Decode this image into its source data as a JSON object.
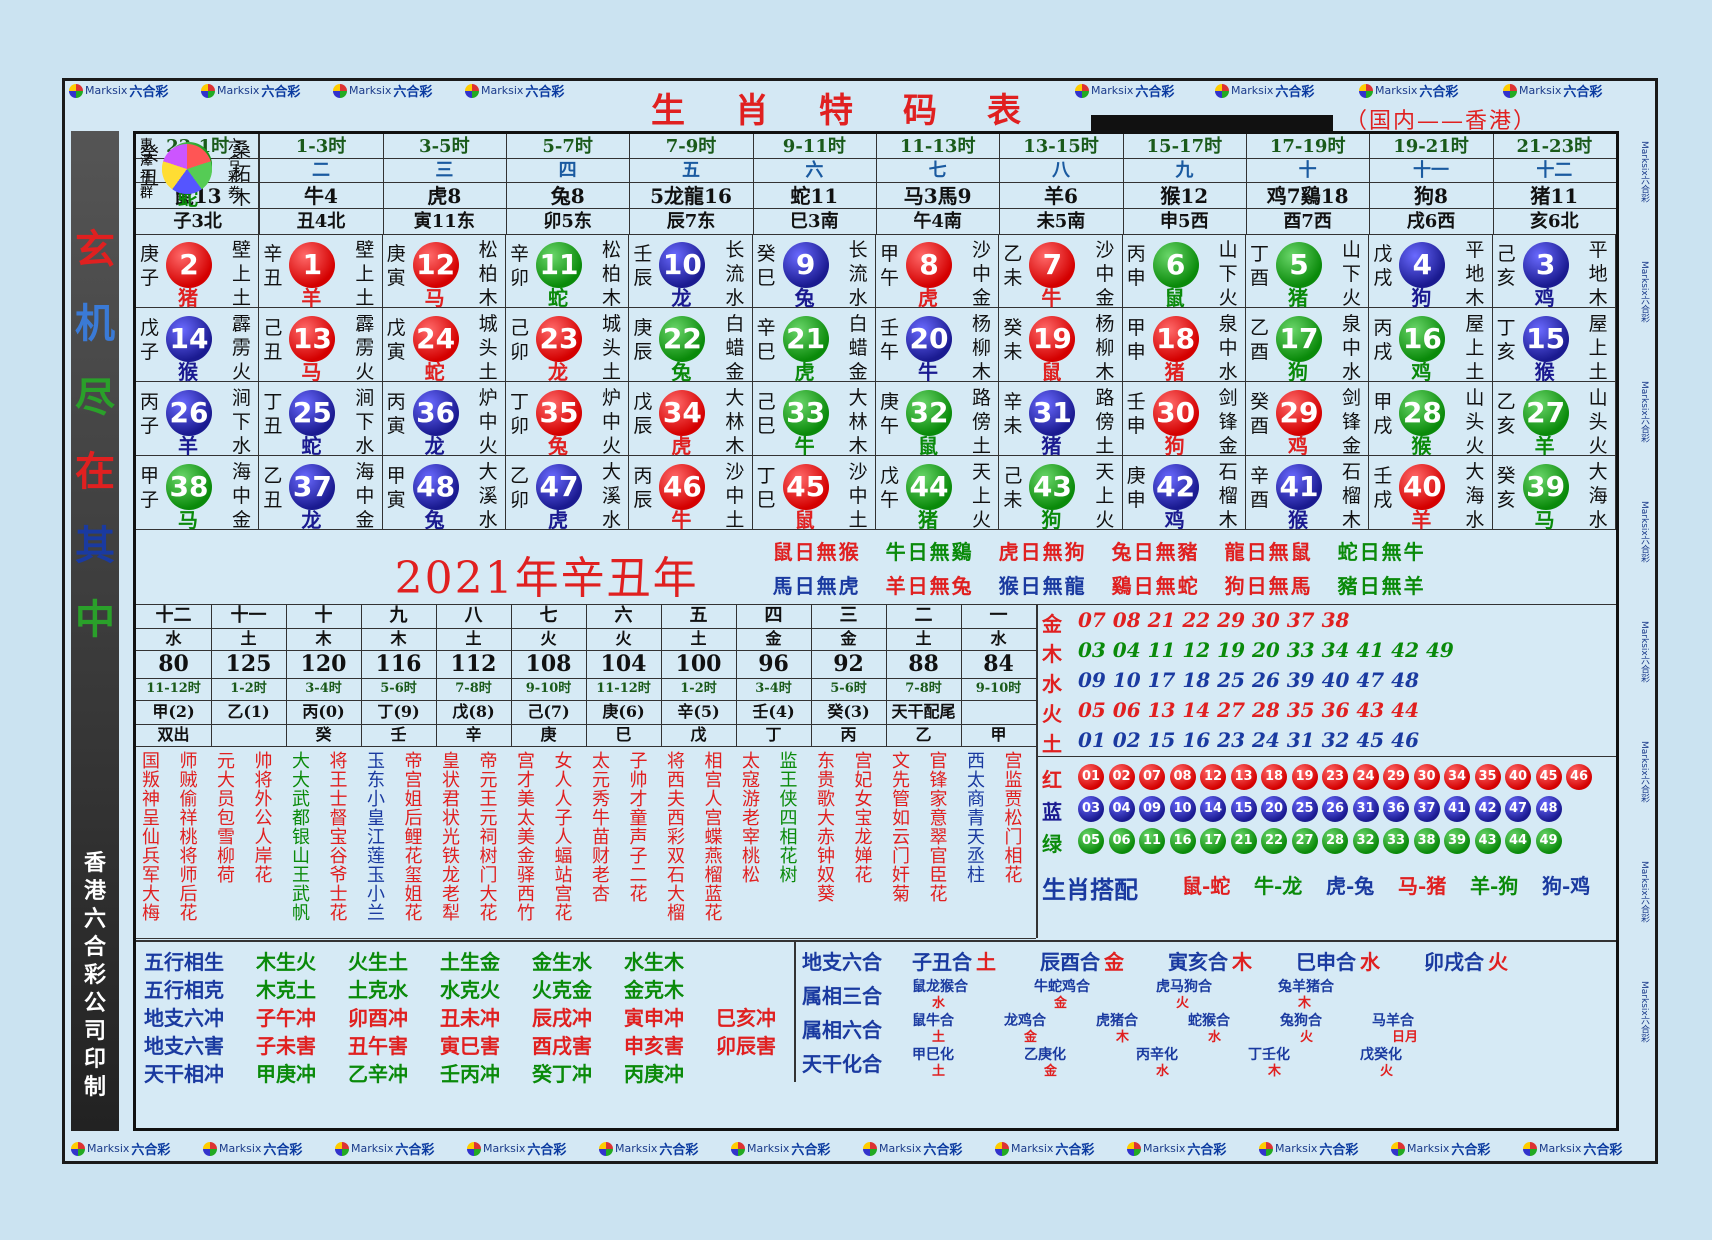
{
  "brand": {
    "name": "Marksix",
    "cn": "六合彩"
  },
  "title": "生肖特码表",
  "subtitle": "（国内——香港）",
  "left_vertical": [
    "玄",
    "机",
    "尽",
    "在",
    "其",
    "中"
  ],
  "left_bottom": "香港六合彩公司印制",
  "hours": [
    "23-1时",
    "1-3时",
    "3-5时",
    "5-7时",
    "7-9时",
    "9-11时",
    "11-13时",
    "13-15时",
    "15-17时",
    "17-19时",
    "19-21时",
    "21-23时"
  ],
  "orders": [
    "一",
    "二",
    "三",
    "四",
    "五",
    "六",
    "七",
    "八",
    "九",
    "十",
    "十一",
    "十二"
  ],
  "zodiacs": [
    "鼠13",
    "牛4",
    "虎8",
    "兔8",
    "5龙龍16",
    "蛇11",
    "马3馬9",
    "羊6",
    "猴12",
    "鸡7鷄18",
    "狗8",
    "猪11"
  ],
  "branches": [
    "子3北",
    "丑4北",
    "寅11东",
    "卯5东",
    "辰7东",
    "巳3南",
    "午4南",
    "未5南",
    "申5西",
    "酉7西",
    "戌6西",
    "亥6北"
  ],
  "rows": [
    [
      [
        "庚子",
        "2",
        "red",
        "猪",
        "壁上土"
      ],
      [
        "辛丑",
        "1",
        "red",
        "羊",
        "壁上土"
      ],
      [
        "庚寅",
        "12",
        "red",
        "马",
        "松柏木"
      ],
      [
        "辛卯",
        "11",
        "green",
        "蛇",
        "松柏木"
      ],
      [
        "壬辰",
        "10",
        "blue",
        "龙",
        "长流水"
      ],
      [
        "癸巳",
        "9",
        "blue",
        "兔",
        "长流水"
      ],
      [
        "甲午",
        "8",
        "red",
        "虎",
        "沙中金"
      ],
      [
        "乙未",
        "7",
        "red",
        "牛",
        "沙中金"
      ],
      [
        "丙申",
        "6",
        "green",
        "鼠",
        "山下火"
      ],
      [
        "丁酉",
        "5",
        "green",
        "猪",
        "山下火"
      ],
      [
        "戊戌",
        "4",
        "blue",
        "狗",
        "平地木"
      ],
      [
        "己亥",
        "3",
        "blue",
        "鸡",
        "平地木"
      ]
    ],
    [
      [
        "戊子",
        "14",
        "blue",
        "猴",
        "霹雳火"
      ],
      [
        "己丑",
        "13",
        "red",
        "马",
        "霹雳火"
      ],
      [
        "戊寅",
        "24",
        "red",
        "蛇",
        "城头土"
      ],
      [
        "己卯",
        "23",
        "red",
        "龙",
        "城头土"
      ],
      [
        "庚辰",
        "22",
        "green",
        "兔",
        "白蜡金"
      ],
      [
        "辛巳",
        "21",
        "green",
        "虎",
        "白蜡金"
      ],
      [
        "壬午",
        "20",
        "blue",
        "牛",
        "杨柳木"
      ],
      [
        "癸未",
        "19",
        "red",
        "鼠",
        "杨柳木"
      ],
      [
        "甲申",
        "18",
        "red",
        "猪",
        "泉中水"
      ],
      [
        "乙酉",
        "17",
        "green",
        "狗",
        "泉中水"
      ],
      [
        "丙戌",
        "16",
        "green",
        "鸡",
        "屋上土"
      ],
      [
        "丁亥",
        "15",
        "blue",
        "猴",
        "屋上土"
      ]
    ],
    [
      [
        "丙子",
        "26",
        "blue",
        "羊",
        "涧下水"
      ],
      [
        "丁丑",
        "25",
        "blue",
        "蛇",
        "涧下水"
      ],
      [
        "丙寅",
        "36",
        "blue",
        "龙",
        "炉中火"
      ],
      [
        "丁卯",
        "35",
        "red",
        "兔",
        "炉中火"
      ],
      [
        "戊辰",
        "34",
        "red",
        "虎",
        "大林木"
      ],
      [
        "己巳",
        "33",
        "green",
        "牛",
        "大林木"
      ],
      [
        "庚午",
        "32",
        "green",
        "鼠",
        "路傍土"
      ],
      [
        "辛未",
        "31",
        "blue",
        "猪",
        "路傍土"
      ],
      [
        "壬申",
        "30",
        "red",
        "狗",
        "剑锋金"
      ],
      [
        "癸酉",
        "29",
        "red",
        "鸡",
        "剑锋金"
      ],
      [
        "甲戌",
        "28",
        "green",
        "猴",
        "山头火"
      ],
      [
        "乙亥",
        "27",
        "green",
        "羊",
        "山头火"
      ]
    ],
    [
      [
        "甲子",
        "38",
        "green",
        "马",
        "海中金"
      ],
      [
        "乙丑",
        "37",
        "blue",
        "龙",
        "海中金"
      ],
      [
        "甲寅",
        "48",
        "blue",
        "兔",
        "大溪水"
      ],
      [
        "乙卯",
        "47",
        "blue",
        "虎",
        "大溪水"
      ],
      [
        "丙辰",
        "46",
        "red",
        "牛",
        "沙中土"
      ],
      [
        "丁巳",
        "45",
        "red",
        "鼠",
        "沙中土"
      ],
      [
        "戊午",
        "44",
        "green",
        "猪",
        "天上火"
      ],
      [
        "己未",
        "43",
        "green",
        "狗",
        "天上火"
      ],
      [
        "庚申",
        "42",
        "blue",
        "鸡",
        "石榴木"
      ],
      [
        "辛酉",
        "41",
        "blue",
        "猴",
        "石榴木"
      ],
      [
        "壬戌",
        "40",
        "red",
        "羊",
        "大海水"
      ],
      [
        "癸亥",
        "39",
        "green",
        "马",
        "大海水"
      ]
    ]
  ],
  "ball49": {
    "gz": "癸丑",
    "num": "49",
    "color": "green",
    "zo": "蛇",
    "ny": "桑柘木"
  },
  "club": {
    "left": "惠澤社群",
    "right": "六合彩券"
  },
  "year": "2021年辛丑年",
  "avoid_top": [
    "鼠日無猴",
    "牛日無鷄",
    "虎日無狗",
    "兔日無豬",
    "龍日無鼠",
    "蛇日無牛"
  ],
  "avoid_bot": [
    "馬日無虎",
    "羊日無兔",
    "猴日無龍",
    "鷄日無蛇",
    "狗日無馬",
    "豬日無羊"
  ],
  "mid_cols": [
    [
      "十二",
      "水",
      "80",
      "11-12时",
      "甲(2)",
      "双出"
    ],
    [
      "十一",
      "土",
      "125",
      "1-2时",
      "乙(1)",
      ""
    ],
    [
      "十",
      "木",
      "120",
      "3-4时",
      "丙(0)",
      "癸"
    ],
    [
      "九",
      "木",
      "116",
      "5-6时",
      "丁(9)",
      "壬"
    ],
    [
      "八",
      "土",
      "112",
      "7-8时",
      "戊(8)",
      "辛"
    ],
    [
      "七",
      "火",
      "108",
      "9-10时",
      "己(7)",
      "庚"
    ],
    [
      "六",
      "火",
      "104",
      "11-12时",
      "庚(6)",
      "巳"
    ],
    [
      "五",
      "土",
      "100",
      "1-2时",
      "辛(5)",
      "戊"
    ],
    [
      "四",
      "金",
      "96",
      "3-4时",
      "壬(4)",
      "丁"
    ],
    [
      "三",
      "金",
      "92",
      "5-6时",
      "癸(3)",
      "丙"
    ],
    [
      "二",
      "土",
      "88",
      "7-8时",
      "天干配尾",
      "乙"
    ],
    [
      "一",
      "水",
      "84",
      "9-10时",
      "",
      "甲"
    ]
  ],
  "poems": [
    "国叛神呈仙兵军大梅",
    "师贼偷祥桃将师后花",
    "元大员包雪柳荷",
    "帅将外公人岸花",
    "大大武都银山王武帆",
    "将王士督宝谷爷士花",
    "玉东小皇江莲玉小兰",
    "帝宫姐后鲤花玺姐花",
    "皇状君状光铁龙老犁",
    "帝元王元祠树门大花",
    "宫才美太美金驿西竹",
    "女人人子人蝠站宫花",
    "太元秀牛苗财老杏",
    "子帅才童声子二花",
    "将西夫西彩双石大榴",
    "相宫人宫蝶燕榴蓝花",
    "太寇游老宰桃松",
    "监王侠四相花树",
    "东贵歌大赤钟奴葵",
    "宫妃女宝龙婵花",
    "文先管如云门奸菊",
    "官锋家意翠官臣花",
    "西太商青天丞柱",
    "宫监贾松门相花"
  ],
  "five_elems": [
    {
      "k": "金",
      "v": "07 08 21 22 29 30 37 38"
    },
    {
      "k": "木",
      "v": "03 04 11 12 19 20 33 34 41 42 49"
    },
    {
      "k": "水",
      "v": "09 10 17 18 25 26 39 40 47 48"
    },
    {
      "k": "火",
      "v": "05 06 13 14 27 28 35 36 43 44"
    },
    {
      "k": "土",
      "v": "01 02 15 16 23 24 31 32 45 46"
    }
  ],
  "wave": {
    "red": {
      "k": "红",
      "nums": [
        "01",
        "02",
        "07",
        "08",
        "12",
        "13",
        "18",
        "19",
        "23",
        "24",
        "29",
        "30",
        "34",
        "35",
        "40",
        "45",
        "46"
      ]
    },
    "blue": {
      "k": "蓝",
      "nums": [
        "03",
        "04",
        "09",
        "10",
        "14",
        "15",
        "20",
        "25",
        "26",
        "31",
        "36",
        "37",
        "41",
        "42",
        "47",
        "48"
      ]
    },
    "green": {
      "k": "绿",
      "nums": [
        "05",
        "06",
        "11",
        "16",
        "17",
        "21",
        "22",
        "27",
        "28",
        "32",
        "33",
        "38",
        "39",
        "43",
        "44",
        "49"
      ]
    }
  },
  "pairing": {
    "label": "生肖搭配",
    "items": [
      "鼠-蛇",
      "牛-龙",
      "虎-兔",
      "马-猪",
      "羊-狗",
      "狗-鸡"
    ]
  },
  "bottom_left": [
    {
      "k": "五行相生",
      "v": [
        "木生火",
        "火生土",
        "土生金",
        "金生水",
        "水生木"
      ]
    },
    {
      "k": "五行相克",
      "v": [
        "木克土",
        "土克水",
        "水克火",
        "火克金",
        "金克木"
      ]
    },
    {
      "k": "地支六冲",
      "v": [
        "子午冲",
        "卯酉冲",
        "丑未冲",
        "辰戌冲",
        "寅申冲",
        "巳亥冲"
      ]
    },
    {
      "k": "地支六害",
      "v": [
        "子未害",
        "丑午害",
        "寅巳害",
        "酉戌害",
        "申亥害",
        "卯辰害"
      ]
    },
    {
      "k": "天干相冲",
      "v": [
        "甲庚冲",
        "乙辛冲",
        "壬丙冲",
        "癸丁冲",
        "丙庚冲"
      ]
    }
  ],
  "bottom_right": {
    "six_he": {
      "k": "地支六合",
      "v": [
        [
          "子丑合",
          "土"
        ],
        [
          "辰酉合",
          "金"
        ],
        [
          "寅亥合",
          "木"
        ],
        [
          "巳申合",
          "水"
        ],
        [
          "卯戌合",
          "火"
        ]
      ]
    },
    "three_he": {
      "k": "属相三合",
      "v": [
        [
          "鼠龙猴合",
          "水"
        ],
        [
          "牛蛇鸡合",
          "金"
        ],
        [
          "虎马狗合",
          "火"
        ],
        [
          "兔羊猪合",
          "木"
        ]
      ]
    },
    "six_he2": {
      "k": "属相六合",
      "v": [
        [
          "鼠牛合",
          "土"
        ],
        [
          "龙鸡合",
          "金"
        ],
        [
          "虎猪合",
          "木"
        ],
        [
          "蛇猴合",
          "水"
        ],
        [
          "兔狗合",
          "火"
        ],
        [
          "马羊合",
          "日月"
        ]
      ]
    },
    "tg_he": {
      "k": "天干化合",
      "v": [
        [
          "甲巳化",
          "土"
        ],
        [
          "乙庚化",
          "金"
        ],
        [
          "丙辛化",
          "水"
        ],
        [
          "丁壬化",
          "木"
        ],
        [
          "戊癸化",
          "火"
        ]
      ]
    }
  }
}
